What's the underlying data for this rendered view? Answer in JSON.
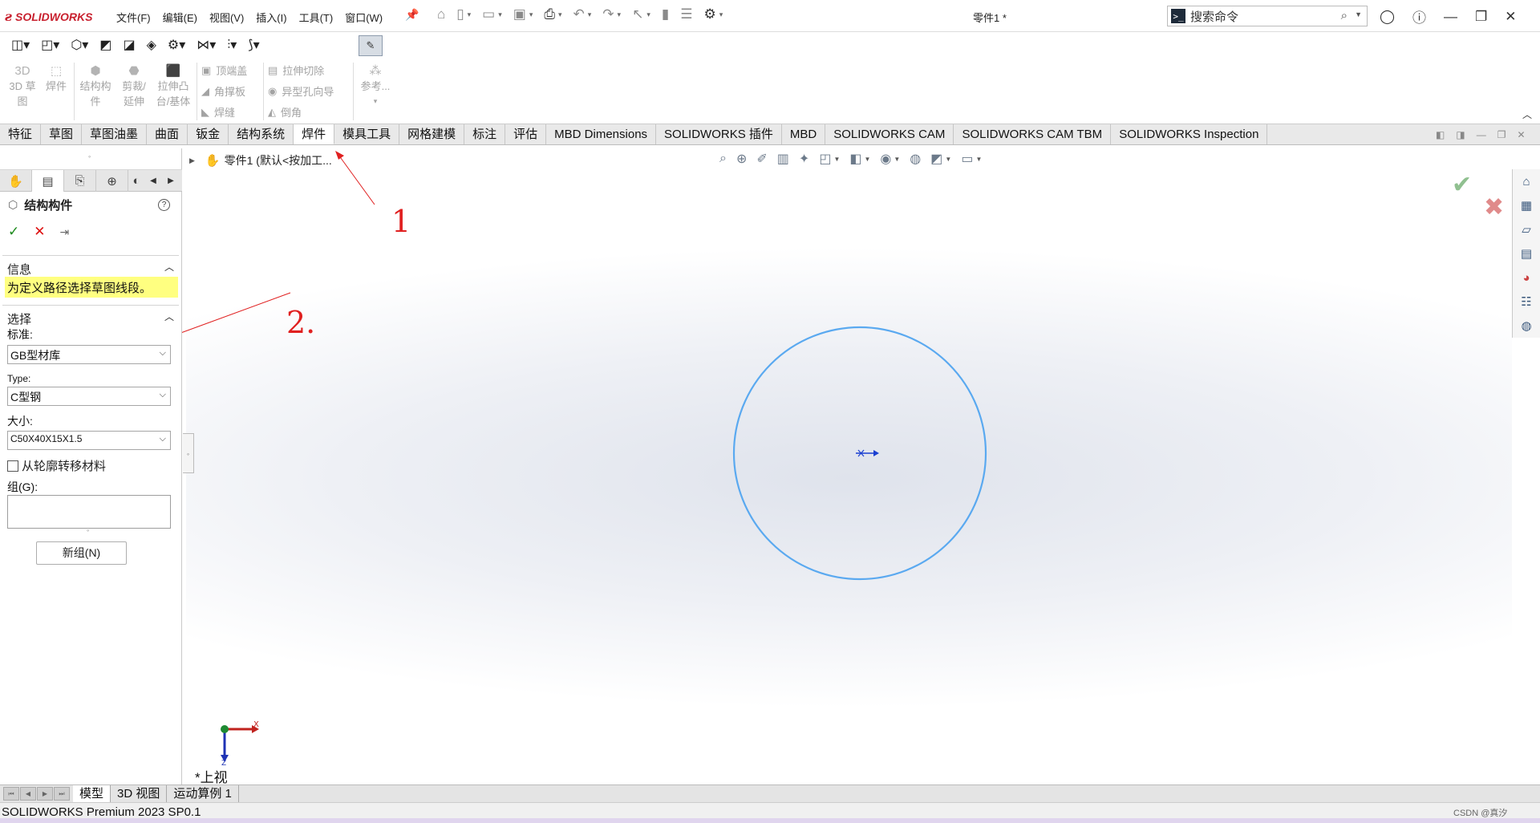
{
  "app": {
    "brand": "SOLIDWORKS",
    "document_title": "零件1 *",
    "menus": [
      "文件(F)",
      "编辑(E)",
      "视图(V)",
      "插入(I)",
      "工具(T)",
      "窗口(W)"
    ],
    "search_placeholder": "搜索命令"
  },
  "ribbon": {
    "large_buttons": [
      {
        "label": "3D 草\n图",
        "icon": "3d-sketch-icon"
      },
      {
        "label": "焊件",
        "icon": "weldment-icon"
      },
      {
        "label": "结构构\n件",
        "icon": "structural-member-icon"
      },
      {
        "label": "剪裁/\n延伸",
        "icon": "trim-extend-icon"
      },
      {
        "label": "拉伸凸\n台/基体",
        "icon": "extruded-boss-icon"
      }
    ],
    "small_buttons": [
      {
        "label": "顶端盖",
        "icon": "end-cap-icon"
      },
      {
        "label": "角撑板",
        "icon": "gusset-icon"
      },
      {
        "label": "焊缝",
        "icon": "weld-bead-icon"
      },
      {
        "label": "拉伸切除",
        "icon": "extruded-cut-icon"
      },
      {
        "label": "异型孔向导",
        "icon": "hole-wizard-icon"
      },
      {
        "label": "倒角",
        "icon": "chamfer-icon"
      }
    ],
    "reference_label": "参考..."
  },
  "tabs": [
    "特征",
    "草图",
    "草图油墨",
    "曲面",
    "钣金",
    "结构系统",
    "焊件",
    "模具工具",
    "网格建模",
    "标注",
    "评估",
    "MBD Dimensions",
    "SOLIDWORKS 插件",
    "MBD",
    "SOLIDWORKS CAM",
    "SOLIDWORKS CAM TBM",
    "SOLIDWORKS Inspection"
  ],
  "active_tab": "焊件",
  "property_manager": {
    "title": "结构构件",
    "info_section": "信息",
    "info_message": "为定义路径选择草图线段。",
    "selection_section": "选择",
    "standard_label": "标准:",
    "standard_value": "GB型材库",
    "type_label": "Type:",
    "type_value": "C型钢",
    "size_label": "大小:",
    "size_value": "C50X40X15X1.5",
    "transfer_material_label": "从轮廓转移材料",
    "transfer_material_checked": false,
    "group_label": "组(G):",
    "new_group_button": "新组(N)"
  },
  "feature_tree": {
    "root_label": "零件1 (默认<按加工..."
  },
  "viewport": {
    "view_name": "*上视",
    "sketch_color": "#5aa9f0"
  },
  "annotations": [
    "1",
    "2."
  ],
  "bottom_tabs": [
    "模型",
    "3D 视图",
    "运动算例 1"
  ],
  "active_bottom_tab": "模型",
  "status": {
    "product": "SOLIDWORKS Premium 2023 SP0.1",
    "watermark": "CSDN @真汐"
  },
  "colors": {
    "brand_red": "#c8202e",
    "annotation_red": "#e02020",
    "info_yellow": "#ffff80",
    "ok_green": "#1b8a1b",
    "cancel_red": "#dd1111"
  }
}
